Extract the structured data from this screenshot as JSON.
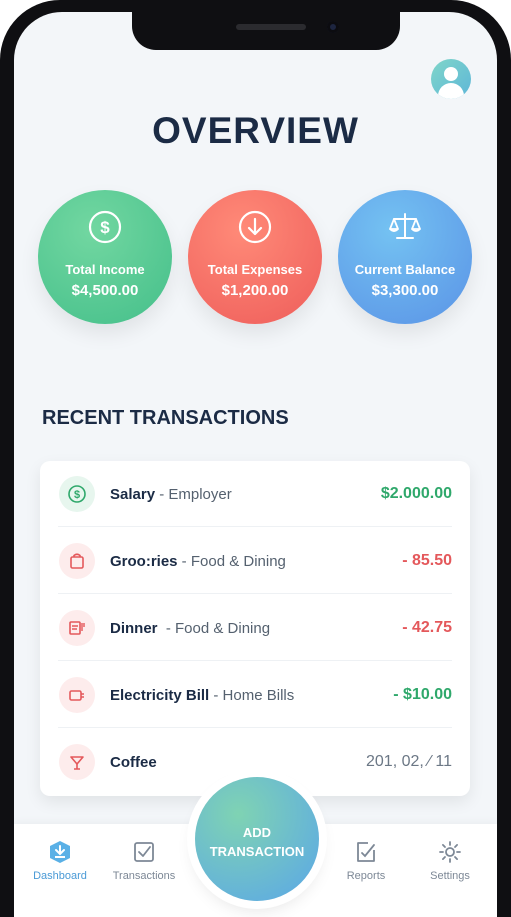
{
  "header": {
    "title": "OVERVIEW"
  },
  "stats": [
    {
      "label": "Total Income",
      "amount": "$4,500.00",
      "icon": "dollar-circle-icon",
      "color": "#4cc28d"
    },
    {
      "label": "Total Expenses",
      "amount": "$1,200.00",
      "icon": "arrow-down-circle-icon",
      "color": "#f06b62"
    },
    {
      "label": "Current Balance",
      "amount": "$3,300.00",
      "icon": "scales-icon",
      "color": "#5f9ee9"
    }
  ],
  "recent": {
    "title": "RECENT TRANSACTIONS",
    "items": [
      {
        "name": "Salary",
        "category": " - Employer",
        "amount": "$2.000.00",
        "icon": "dollar-icon"
      },
      {
        "name": "Groo:ries",
        "category": " - Food & Dining",
        "amount": "- 85.50",
        "icon": "shopping-bag-icon"
      },
      {
        "name": "Dinner",
        "category": "  - Food & Dining",
        "amount": "- 42.75",
        "icon": "receipt-icon"
      },
      {
        "name": "Electricity Bill",
        "category": " - Home Bills",
        "amount": "- $10.00",
        "icon": "plug-icon"
      },
      {
        "name": "Coffee",
        "category": "",
        "amount": "201, 02, ⁄ 11",
        "icon": "coffee-icon"
      }
    ]
  },
  "fab": {
    "line1": "ADD",
    "line2": "TRANSACTION"
  },
  "tabs": [
    {
      "label": "Dashboard",
      "icon": "dashboard-icon",
      "active": true
    },
    {
      "label": "Transactions",
      "icon": "check-square-icon"
    },
    {
      "label": "Reports",
      "icon": "report-icon"
    },
    {
      "label": "Settings",
      "icon": "gear-icon"
    }
  ],
  "colors": {
    "accent": "#4a9ad6",
    "positive": "#2fa86b",
    "negative": "#e4585b",
    "title": "#1b2b45"
  }
}
